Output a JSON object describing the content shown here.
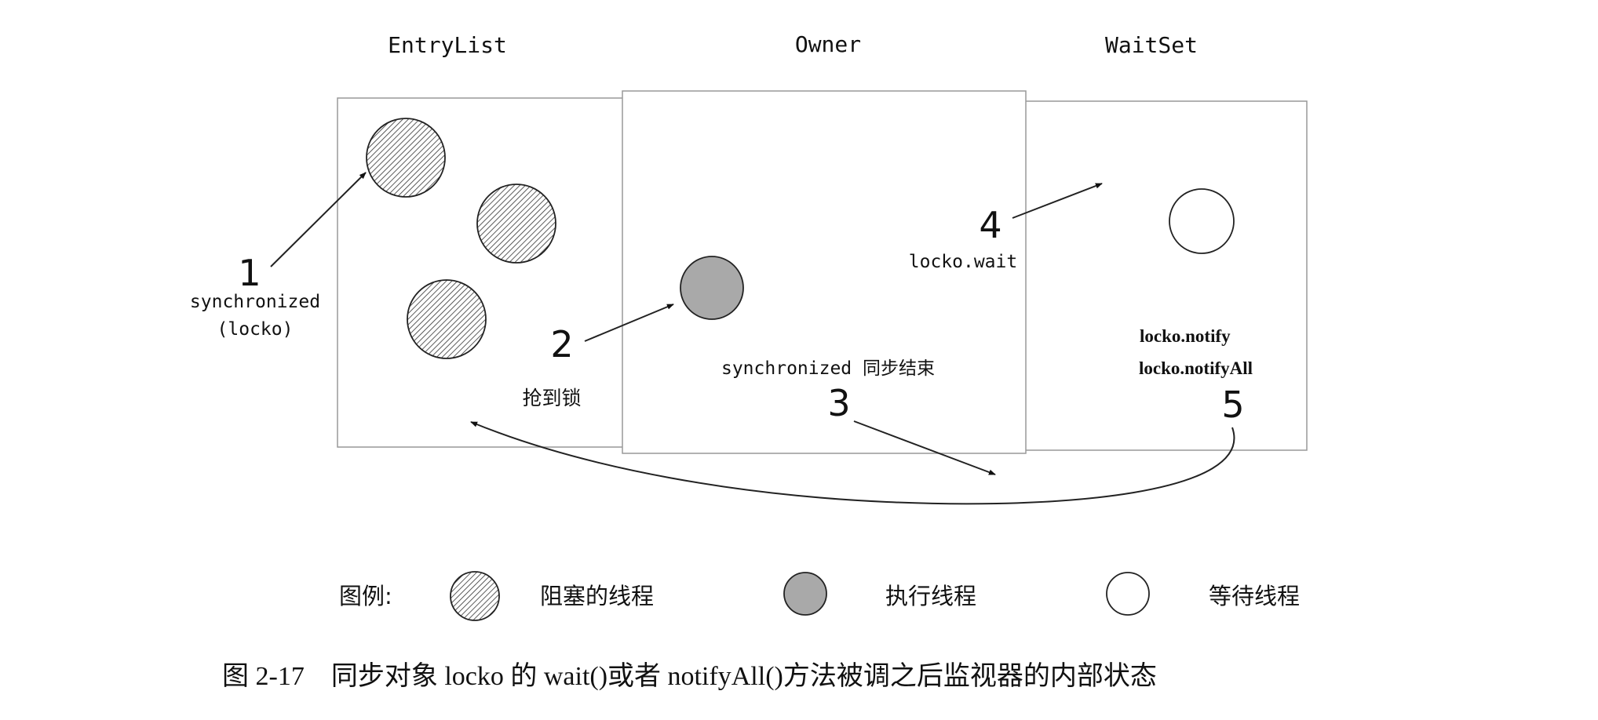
{
  "regions": {
    "entry_list": "EntryList",
    "owner": "Owner",
    "wait_set": "WaitSet"
  },
  "steps": {
    "s1": {
      "num": "1",
      "line1": "synchronized",
      "line2": "(locko)"
    },
    "s2": {
      "num": "2",
      "label": "抢到锁"
    },
    "s3": {
      "num": "3",
      "label": "synchronized 同步结束"
    },
    "s4": {
      "num": "4",
      "label": "locko.wait"
    },
    "s5": {
      "num": "5",
      "line1": "locko.notify",
      "line2": "locko.notifyAll"
    }
  },
  "legend": {
    "title": "图例:",
    "blocked": "阻塞的线程",
    "running": "执行线程",
    "waiting": "等待线程"
  },
  "caption": "图 2-17　同步对象 locko 的 wait()或者 notifyAll()方法被调之后监视器的内部状态",
  "colors": {
    "line": "#222222",
    "box_border": "#999999",
    "running_fill": "#a9a9a9",
    "hatch": "#333333"
  }
}
